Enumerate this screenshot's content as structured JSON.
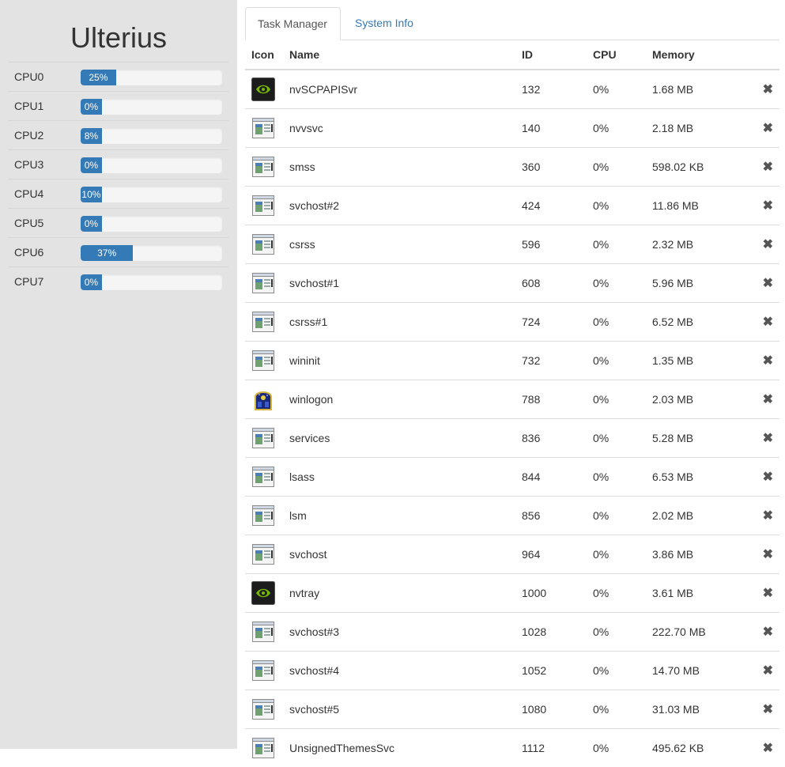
{
  "app": {
    "title": "Ulterius"
  },
  "cpus": [
    {
      "label": "CPU0",
      "value_text": "25%",
      "percent": 25
    },
    {
      "label": "CPU1",
      "value_text": "0%",
      "percent": 0
    },
    {
      "label": "CPU2",
      "value_text": "8%",
      "percent": 8
    },
    {
      "label": "CPU3",
      "value_text": "0%",
      "percent": 0
    },
    {
      "label": "CPU4",
      "value_text": "10%",
      "percent": 10
    },
    {
      "label": "CPU5",
      "value_text": "0%",
      "percent": 0
    },
    {
      "label": "CPU6",
      "value_text": "37%",
      "percent": 37
    },
    {
      "label": "CPU7",
      "value_text": "0%",
      "percent": 0
    }
  ],
  "tabs": [
    {
      "label": "Task Manager",
      "active": true
    },
    {
      "label": "System Info",
      "active": false
    }
  ],
  "table": {
    "headers": {
      "icon": "Icon",
      "name": "Name",
      "id": "ID",
      "cpu": "CPU",
      "memory": "Memory"
    },
    "kill_glyph": "✖",
    "rows": [
      {
        "icon": "nvidia-icon",
        "name": "nvSCPAPISvr",
        "id": "132",
        "cpu": "0%",
        "memory": "1.68 MB"
      },
      {
        "icon": "application-window-icon",
        "name": "nvvsvc",
        "id": "140",
        "cpu": "0%",
        "memory": "2.18 MB"
      },
      {
        "icon": "application-window-icon",
        "name": "smss",
        "id": "360",
        "cpu": "0%",
        "memory": "598.02 KB"
      },
      {
        "icon": "application-window-icon",
        "name": "svchost#2",
        "id": "424",
        "cpu": "0%",
        "memory": "11.86 MB"
      },
      {
        "icon": "application-window-icon",
        "name": "csrss",
        "id": "596",
        "cpu": "0%",
        "memory": "2.32 MB"
      },
      {
        "icon": "application-window-icon",
        "name": "svchost#1",
        "id": "608",
        "cpu": "0%",
        "memory": "5.96 MB"
      },
      {
        "icon": "application-window-icon",
        "name": "csrss#1",
        "id": "724",
        "cpu": "0%",
        "memory": "6.52 MB"
      },
      {
        "icon": "application-window-icon",
        "name": "wininit",
        "id": "732",
        "cpu": "0%",
        "memory": "1.35 MB"
      },
      {
        "icon": "winlogon-icon",
        "name": "winlogon",
        "id": "788",
        "cpu": "0%",
        "memory": "2.03 MB"
      },
      {
        "icon": "application-window-icon",
        "name": "services",
        "id": "836",
        "cpu": "0%",
        "memory": "5.28 MB"
      },
      {
        "icon": "application-window-icon",
        "name": "lsass",
        "id": "844",
        "cpu": "0%",
        "memory": "6.53 MB"
      },
      {
        "icon": "application-window-icon",
        "name": "lsm",
        "id": "856",
        "cpu": "0%",
        "memory": "2.02 MB"
      },
      {
        "icon": "application-window-icon",
        "name": "svchost",
        "id": "964",
        "cpu": "0%",
        "memory": "3.86 MB"
      },
      {
        "icon": "nvidia-icon",
        "name": "nvtray",
        "id": "1000",
        "cpu": "0%",
        "memory": "3.61 MB"
      },
      {
        "icon": "application-window-icon",
        "name": "svchost#3",
        "id": "1028",
        "cpu": "0%",
        "memory": "222.70 MB"
      },
      {
        "icon": "application-window-icon",
        "name": "svchost#4",
        "id": "1052",
        "cpu": "0%",
        "memory": "14.70 MB"
      },
      {
        "icon": "application-window-icon",
        "name": "svchost#5",
        "id": "1080",
        "cpu": "0%",
        "memory": "31.03 MB"
      },
      {
        "icon": "application-window-icon",
        "name": "UnsignedThemesSvc",
        "id": "1112",
        "cpu": "0%",
        "memory": "495.62 KB"
      }
    ]
  },
  "colors": {
    "sidebar_bg": "#e3e3e3",
    "progress_fill": "#337ab7",
    "link": "#337ab7"
  }
}
